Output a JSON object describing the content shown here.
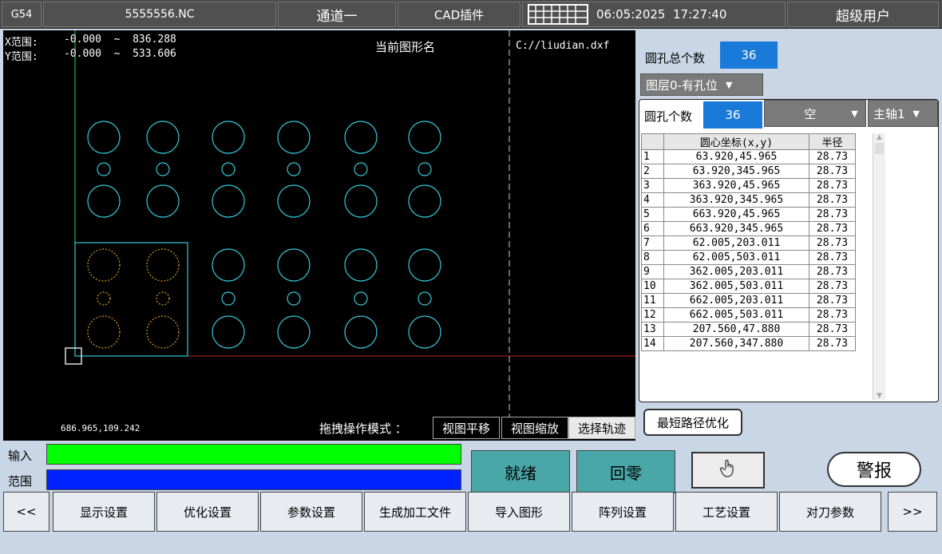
{
  "topbar": {
    "coord_sys": "G54",
    "file_name": "5555556.NC",
    "channel": "通道一",
    "plugin": "CAD插件",
    "keyboard_icon": "keyboard-icon",
    "datetime": "06:05:2025  17:27:40",
    "user": "超级用户"
  },
  "canvas": {
    "x_range_label": "X范围:",
    "x_range_value": "-0.000  ~  836.288",
    "y_range_label": "Y范围:",
    "y_range_value": "-0.000  ~  533.606",
    "shape_name_label": "当前图形名",
    "file_path": "C://liudian.dxf",
    "cursor_coords": "686.965,109.242",
    "drag_mode_label": "拖拽操作模式  ：",
    "mode_pan": "视图平移",
    "mode_zoom": "视图缩放",
    "mode_select": "选择轨迹"
  },
  "colors": {
    "holes": "#35c9d9",
    "selected_holes": "#e0a020",
    "input_bar": "#00ff00",
    "range_bar": "#0022ff",
    "status_teal": "#4aa7a7"
  },
  "panel": {
    "total_holes_label": "圆孔总个数",
    "total_holes_value": "36",
    "layer_select": "图层0-有孔位",
    "holes_label": "圆孔个数",
    "holes_value": "36",
    "empty_select": "空",
    "spindle_select": "主轴1",
    "table_headers": [
      "",
      "圆心坐标(x,y)",
      "半径"
    ],
    "rows": [
      [
        "1",
        "63.920,45.965",
        "28.73"
      ],
      [
        "2",
        "63.920,345.965",
        "28.73"
      ],
      [
        "3",
        "363.920,45.965",
        "28.73"
      ],
      [
        "4",
        "363.920,345.965",
        "28.73"
      ],
      [
        "5",
        "663.920,45.965",
        "28.73"
      ],
      [
        "6",
        "663.920,345.965",
        "28.73"
      ],
      [
        "7",
        "62.005,203.011",
        "28.73"
      ],
      [
        "8",
        "62.005,503.011",
        "28.73"
      ],
      [
        "9",
        "362.005,203.011",
        "28.73"
      ],
      [
        "10",
        "362.005,503.011",
        "28.73"
      ],
      [
        "11",
        "662.005,203.011",
        "28.73"
      ],
      [
        "12",
        "662.005,503.011",
        "28.73"
      ],
      [
        "13",
        "207.560,47.880",
        "28.73"
      ],
      [
        "14",
        "207.560,347.880",
        "28.73"
      ]
    ],
    "optimize_button": "最短路径优化"
  },
  "io": {
    "input_label": "输入",
    "range_label": "范围"
  },
  "status": {
    "ready": "就绪",
    "home": "回零",
    "hand_icon": "hand-pointer-icon",
    "alarm": "警报"
  },
  "nav": {
    "prev": "<<",
    "items": [
      "显示设置",
      "优化设置",
      "参数设置",
      "生成加工文件",
      "导入图形",
      "阵列设置",
      "工艺设置",
      "对刀参数"
    ],
    "next": ">>"
  }
}
